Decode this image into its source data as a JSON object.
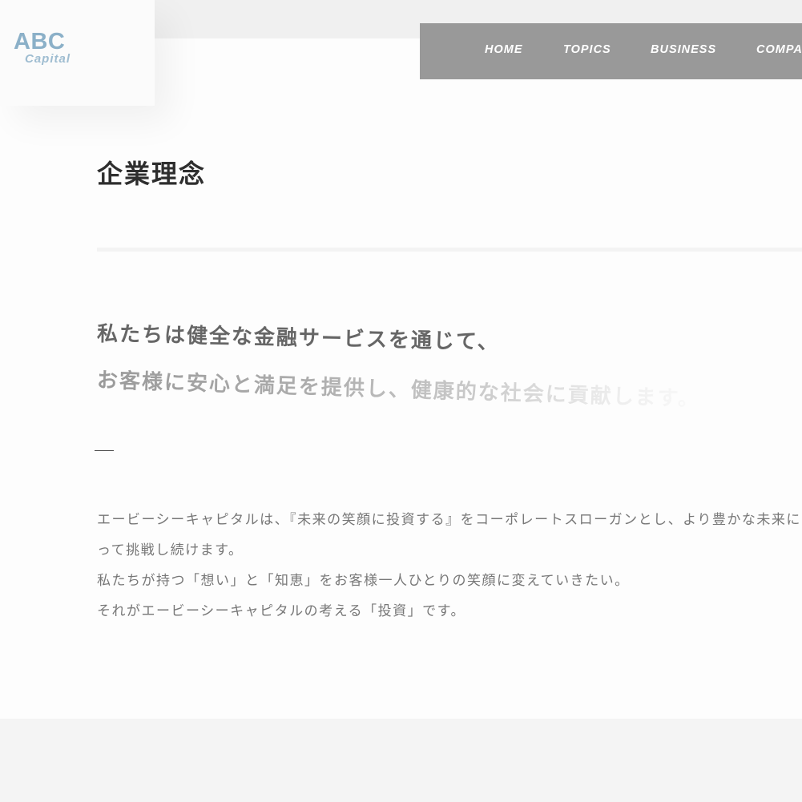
{
  "logo": {
    "abc": "ABC",
    "capital": "Capital"
  },
  "nav": {
    "items": [
      {
        "label": "HOME"
      },
      {
        "label": "TOPICS"
      },
      {
        "label": "BUSINESS"
      },
      {
        "label": "COMPANY"
      }
    ]
  },
  "main": {
    "title": "企業理念",
    "mission": {
      "line1": "私たちは健全な金融サービスを通じて、",
      "line2": "お客様に安心と満足を提供し、健康的な社会に貢献します。"
    },
    "body": {
      "line1": "エービーシーキャピタルは、『未来の笑顔に投資する』をコーポレートスローガンとし、より豊かな未来に向か",
      "line2": "って挑戦し続けます。",
      "line3": "私たちが持つ「想い」と「知恵」をお客様一人ひとりの笑顔に変えていきたい。",
      "line4": "それがエービーシーキャピタルの考える「投資」です。"
    }
  },
  "colors": {
    "logo": "#8bb0c8",
    "nav_bg": "#999999",
    "nav_text": "#ffffff",
    "title": "#2e2e2e",
    "body_text": "#777777"
  }
}
